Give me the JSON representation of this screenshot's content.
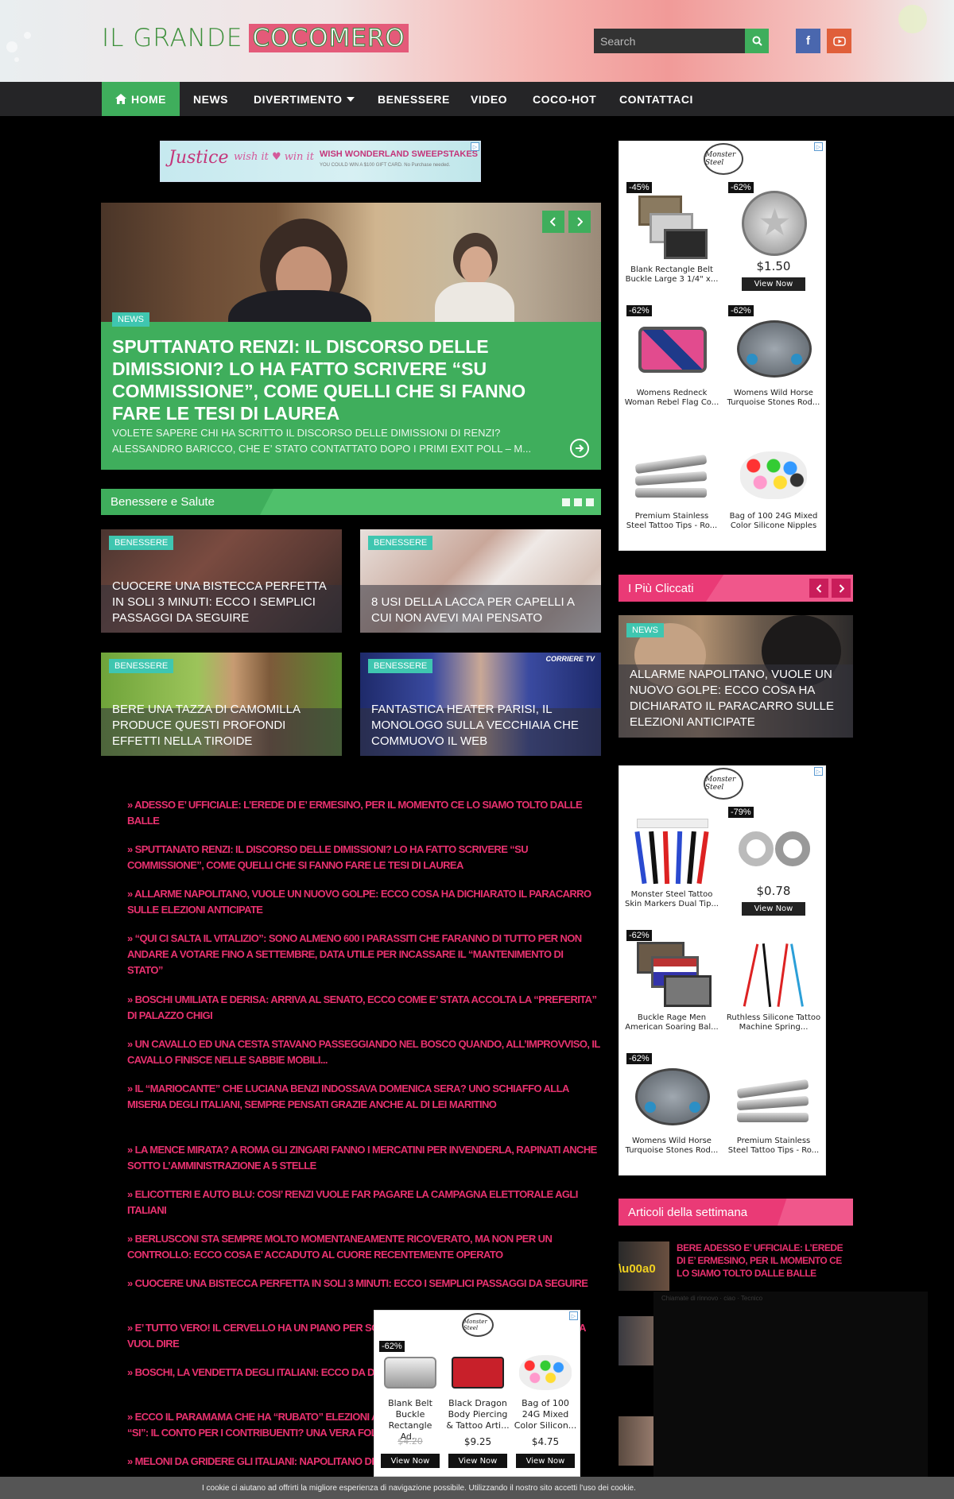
{
  "header": {
    "logo_part1": "IL GRANDE",
    "logo_part2": "COCOMERO",
    "search_placeholder": "Search",
    "facebook_label": "f",
    "youtube_label": "You▶"
  },
  "nav": {
    "items": [
      "HOME",
      "NEWS",
      "DIVERTIMENTO",
      "BENESSERE",
      "VIDEO",
      "COCO-HOT",
      "CONTATTACI"
    ]
  },
  "top_ad": {
    "brand": "Justice",
    "tagline": "wish it ♥ win it",
    "headline": "WISH WONDERLAND SWEEPSTAKES",
    "subline": "YOU COULD WIN A $100 GIFT CARD. No Purchase needed."
  },
  "hero": {
    "badge": "NEWS",
    "title": "SPUTTANATO RENZI: IL DISCORSO DELLE DIMISSIONI? LO HA FATTO SCRIVERE “SU COMMISSIONE”, COME QUELLI CHE SI FANNO FARE LE TESI DI LAUREA",
    "excerpt": "VOLETE SAPERE CHI HA SCRITTO IL DISCORSO DELLE DIMISSIONI DI RENZI? ALESSANDRO BARICCO, CHE E’ STATO CONTATTATO DOPO I PRIMI EXIT POLL – M..."
  },
  "benessere": {
    "section_title": "Benessere e Salute",
    "cards": [
      {
        "badge": "BENESSERE",
        "title": "CUOCERE UNA BISTECCA PERFETTA IN SOLI 3 MINUTI: ECCO I SEMPLICI PASSAGGI DA SEGUIRE"
      },
      {
        "badge": "BENESSERE",
        "title": "8 USI DELLA LACCA PER CAPELLI A CUI NON AVEVI MAI PENSATO"
      },
      {
        "badge": "BENESSERE",
        "title": "BERE UNA TAZZA DI CAMOMILLA PRODUCE QUESTI PROFONDI EFFETTI NELLA TIROIDE"
      },
      {
        "badge": "BENESSERE",
        "title": "FANTASTICA HEATER PARISI, IL MONOLOGO SULLA VECCHIAIA CHE COMMUOVO IL WEB",
        "corner": "CORRIERE TV"
      }
    ]
  },
  "link_list": [
    "» ADESSO E’ UFFICIALE: L’EREDE DI E’ ERMESINO, PER IL MOMENTO CE LO SIAMO TOLTO DALLE BALLE",
    "» SPUTTANATO RENZI: IL DISCORSO DELLE DIMISSIONI? LO HA FATTO SCRIVERE “SU COMMISSIONE”, COME QUELLI CHE SI FANNO FARE LE TESI DI LAUREA",
    "» ALLARME NAPOLITANO, VUOLE UN NUOVO GOLPE: ECCO COSA HA DICHIARATO IL PARACARRO SULLE ELEZIONI ANTICIPATE",
    "» “QUI CI SALTA IL VITALIZIO”: SONO ALMENO 600 I PARASSITI CHE FARANNO DI TUTTO PER NON ANDARE A VOTARE FINO A SETTEMBRE, DATA UTILE PER INCASSARE IL “MANTENIMENTO DI STATO”",
    "» BOSCHI UMILIATA E DERISA: ARRIVA AL SENATO, ECCO COME E’ STATA ACCOLTA LA “PREFERITA” DI PALAZZO CHIGI",
    "» UN CAVALLO ED UNA CESTA STAVANO PASSEGGIANDO NEL BOSCO QUANDO, ALL’IMPROVVISO, IL CAVALLO FINISCE NELLE SABBIE MOBILI...",
    "» IL “MARIOCANTE” CHE LUCIANA BENZI INDOSSAVA DOMENICA SERA? UNO SCHIAFFO ALLA MISERIA DEGLI ITALIANI, SEMPRE PENSATI GRAZIE ANCHE AL DI LEI MARITINO",
    "» LA MENCE MIRATA? A ROMA GLI ZINGARI FANNO I MERCATINI PER INVENDERLA, RAPINATI ANCHE SOTTO L’AMMINISTRAZIONE A 5 STELLE",
    "» ELICOTTERI E AUTO BLU: COSI’ RENZI VUOLE FAR PAGARE LA CAMPAGNA ELETTORALE AGLI ITALIANI",
    "» BERLUSCONI STA SEMPRE MOLTO MOMENTANEAMENTE RICOVERATO, MA NON PER UN CONTROLLO: ECCO COSA E’ ACCADUTO AL CUORE RECENTEMENTE OPERATO",
    "» CUOCERE UNA BISTECCA PERFETTA IN SOLI 3 MINUTI: ECCO I SEMPLICI PASSAGGI DA SEGUIRE",
    "» E’ TUTTO VERO! IL CERVELLO HA UN PIANO PER SOPRAVVIVERE ALLA VECCHIAIA: ECCO COSA VUOL DIRE",
    "» BOSCHI, LA VENDETTA DEGLI ITALIANI: ECCO DA DOVE ARRIVERA’ IL PRIMO COLPO",
    "» ECCO IL PARAMAMA CHE HA “RUBATO” ELEZIONI AL PD: LA LISTA DI TUTTE LE CHIAMATE DEL “SI”: IL CONTO PER I CONTRIBUENTI? UNA VERA FOLLIA",
    "» MELONI DA GRIDERE GLI ITALIANI: NAPOLITANO DEVE ANDARE A CASA"
  ],
  "sidebar": {
    "ad1": {
      "logo": "Monster Steel",
      "products": [
        {
          "discount": "-45%",
          "name": "Blank Rectangle Belt Buckle Large 3 1/4\" x...",
          "price": "",
          "button": ""
        },
        {
          "discount": "-62%",
          "name": "",
          "price": "$1.50",
          "button": "View Now"
        },
        {
          "discount": "-62%",
          "name": "Womens Redneck Woman Rebel Flag Co...",
          "price": "",
          "button": ""
        },
        {
          "discount": "-62%",
          "name": "Womens Wild Horse Turquoise Stones Rod...",
          "price": "",
          "button": ""
        },
        {
          "discount": "",
          "name": "Premium Stainless Steel Tattoo Tips - Ro...",
          "price": "",
          "button": ""
        },
        {
          "discount": "",
          "name": "Bag of 100 24G Mixed Color Silicone Nipples",
          "price": "",
          "button": ""
        }
      ]
    },
    "cliccati": {
      "title": "I Più Cliccati",
      "badge": "NEWS",
      "headline": "ALLARME NAPOLITANO, VUOLE UN NUOVO GOLPE: ECCO COSA HA DICHIARATO IL PARACARRO SULLE ELEZIONI ANTICIPATE"
    },
    "ad2": {
      "logo": "Monster Steel",
      "products": [
        {
          "discount": "",
          "name": "Monster Steel Tattoo Skin Markers Dual Tip...",
          "price": "",
          "button": ""
        },
        {
          "discount": "-79%",
          "name": "",
          "price": "$0.78",
          "button": "View Now"
        },
        {
          "discount": "-62%",
          "name": "Buckle Rage Men American Soaring Bal...",
          "price": "",
          "button": ""
        },
        {
          "discount": "",
          "name": "Ruthless Silicone Tattoo Machine Spring...",
          "price": "",
          "button": ""
        },
        {
          "discount": "-62%",
          "name": "Womens Wild Horse Turquoise Stones Rod...",
          "price": "",
          "button": ""
        },
        {
          "discount": "",
          "name": "Premium Stainless Steel Tattoo Tips - Ro...",
          "price": "",
          "button": ""
        }
      ]
    },
    "week": {
      "title": "Articoli della settimana",
      "first_title": "BERE ADESSO E’ UFFICIALE: L’EREDE DI E’ ERMESINO, PER IL MOMENTO CE LO SIAMO TOLTO DALLE BALLE"
    }
  },
  "float_ad": {
    "logo": "Monster Steel",
    "products": [
      {
        "discount": "-62%",
        "name": "Blank Belt Buckle Rectangle Ad...",
        "old_price": "$4.20",
        "price": "",
        "button": "View Now"
      },
      {
        "discount": "",
        "name": "Black Dragon Body Piercing & Tattoo Arti...",
        "old_price": "",
        "price": "$9.25",
        "button": "View Now"
      },
      {
        "discount": "",
        "name": "Bag of 100 24G Mixed Color Silicon...",
        "old_price": "",
        "price": "$4.75",
        "button": "View Now"
      }
    ]
  },
  "overlay_caption": "Chiamate di rinnovo · ciao · Tecnico",
  "cookie_bar": {
    "text": "I cookie ci aiutano ad offrirti la migliore esperienza di navigazione possibile. Utilizzando il nostro sito accetti l'uso dei cookie."
  },
  "colors": {
    "green": "#3fae5c",
    "pink": "#ea3a76",
    "nav_bg": "#252527",
    "teal_badge": "#3fc6b0"
  }
}
